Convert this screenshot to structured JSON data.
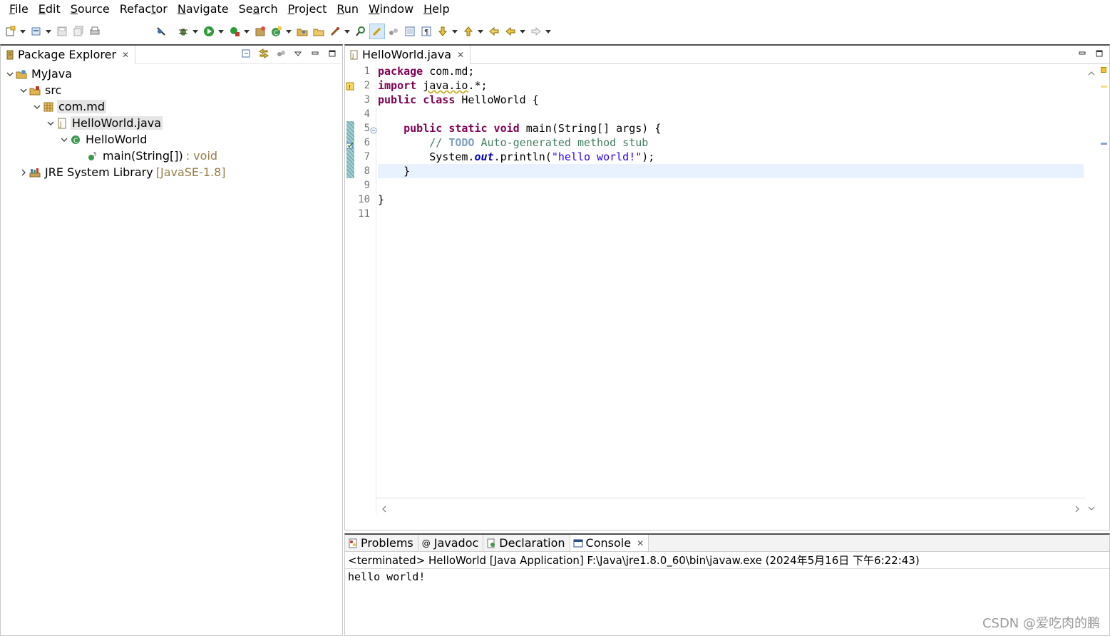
{
  "menu": [
    {
      "label": "File",
      "mn": "F",
      "rest": "ile"
    },
    {
      "label": "Edit",
      "mn": "E",
      "rest": "dit"
    },
    {
      "label": "Source",
      "mn": "S",
      "rest": "ource"
    },
    {
      "label": "Refactor",
      "pre": "Refac",
      "mn": "t",
      "rest": "or"
    },
    {
      "label": "Navigate",
      "mn": "N",
      "rest": "avigate"
    },
    {
      "label": "Search",
      "pre": "Se",
      "mn": "a",
      "rest": "rch"
    },
    {
      "label": "Project",
      "mn": "P",
      "rest": "roject"
    },
    {
      "label": "Run",
      "mn": "R",
      "rest": "un"
    },
    {
      "label": "Window",
      "mn": "W",
      "rest": "indow"
    },
    {
      "label": "Help",
      "mn": "H",
      "rest": "elp"
    }
  ],
  "package_explorer": {
    "title": "Package Explorer",
    "tree": {
      "project": "MyJava",
      "src": "src",
      "package": "com.md",
      "file": "HelloWorld.java",
      "class": "HelloWorld",
      "method": "main(String[])",
      "method_return": " : void",
      "jre": "JRE System Library",
      "jre_version": "[JavaSE-1.8]"
    }
  },
  "editor": {
    "tab_title": "HelloWorld.java",
    "current_line": 8,
    "changed_lines": [
      5,
      8
    ],
    "line_numbers": [
      "1",
      "2",
      "3",
      "4",
      "5",
      "6",
      "7",
      "8",
      "9",
      "10",
      "11"
    ],
    "lines": [
      {
        "kw1": "package",
        "text": " com.md;"
      },
      {
        "kw1": "import",
        "text": " ",
        "warn": "java.io",
        "text2": ".*;"
      },
      {
        "kw1": "public",
        "kw2": " class",
        "text": " HelloWorld {"
      },
      {},
      {
        "indent": "    ",
        "kw1": "public",
        "kw2": " static",
        "kw3": " void",
        "text": " main(String[] args) {"
      },
      {
        "indent": "        ",
        "comment": "// ",
        "todo": "TODO",
        "comment2": " Auto-generated method stub"
      },
      {
        "indent": "        ",
        "text": "System.",
        "field": "out",
        "text2": ".println(",
        "string": "\"hello world!\"",
        "text3": ");"
      },
      {
        "indent": "    ",
        "text": "}"
      },
      {},
      {
        "text": "}"
      },
      {}
    ]
  },
  "console": {
    "tabs": [
      {
        "label": "Problems",
        "icon": "problems-icon"
      },
      {
        "label": "Javadoc",
        "icon": "javadoc-icon"
      },
      {
        "label": "Declaration",
        "icon": "declaration-icon"
      },
      {
        "label": "Console",
        "icon": "console-icon",
        "active": true
      }
    ],
    "status": "<terminated> HelloWorld [Java Application] F:\\Java\\jre1.8.0_60\\bin\\javaw.exe (2024年5月16日 下午6:22:43)",
    "output": "hello world!"
  },
  "watermark": "CSDN @爱吃肉的鹏",
  "colors": {
    "keyword": "#7f0055",
    "comment": "#3f7f5f",
    "string": "#2a00ff",
    "field": "#0000c0",
    "current_line": "#e8f2fe",
    "selection": "#e5e5e5"
  }
}
